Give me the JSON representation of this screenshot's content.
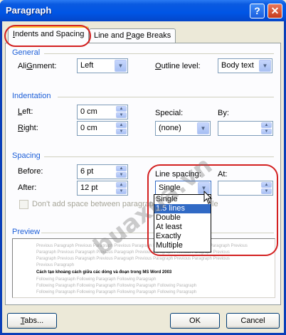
{
  "window": {
    "title": "Paragraph",
    "help_glyph": "?",
    "close_glyph": "✕"
  },
  "tabs": [
    {
      "label": "Indents and Spacing",
      "mnemonic": "I",
      "rest": "ndents and Spacing",
      "active": true
    },
    {
      "label": "Line and Page Breaks",
      "mnemonic": "P",
      "pre": "Line and ",
      "rest": "age Breaks",
      "active": false
    }
  ],
  "general": {
    "title": "General",
    "alignment_label": "Alignment:",
    "alignment_mn": "G",
    "alignment_value": "Left",
    "outline_label": "Outline level:",
    "outline_mn": "O",
    "outline_value": "Body text"
  },
  "indentation": {
    "title": "Indentation",
    "left_label": "Left:",
    "left_mn": "L",
    "left_value": "0 cm",
    "right_label": "Right:",
    "right_mn": "R",
    "right_value": "0 cm",
    "special_label": "Special:",
    "special_value": "(none)",
    "by_label": "By:",
    "by_value": ""
  },
  "spacing": {
    "title": "Spacing",
    "before_label": "Before:",
    "before_value": "6 pt",
    "after_label": "After:",
    "after_value": "12 pt",
    "line_spacing_label": "Line spacing:",
    "line_spacing_value": "Single",
    "at_label": "At:",
    "at_value": "",
    "dont_add_label": "Don't add space between paragraph",
    "dont_add_tail": "le",
    "line_spacing_options": [
      "Single",
      "1.5 lines",
      "Double",
      "At least",
      "Exactly",
      "Multiple"
    ],
    "line_spacing_selected": "1.5 lines"
  },
  "preview": {
    "title": "Preview",
    "previous_lines": [
      "Previous Paragraph Previous Paragraph Previous Paragraph Previous Paragraph Previous Paragraph Previous",
      "Paragraph Previous Paragraph Previous Paragraph Previous Paragraph Previous Paragraph Previous",
      "Paragraph Previous Paragraph Previous Paragraph Previous Paragraph Previous Paragraph Previous",
      "Previous Paragraph"
    ],
    "current_line": "Cách tạo khoảng cách giữa các dòng và đoạn trong MS Word 2003",
    "following_lines": [
      "Following Paragraph Following Paragraph Following Paragraph",
      "Following Paragraph Following Paragraph Following Paragraph Following Paragraph",
      "Following Paragraph Following Paragraph Following Paragraph Following Paragraph",
      "Following Paragraph Following Paragraph Following Paragraph Following Paragraph"
    ]
  },
  "buttons": {
    "tabs": "Tabs...",
    "ok": "OK",
    "cancel": "Cancel"
  },
  "watermark": "buaxua.vn",
  "colors": {
    "section_title": "#1d5fd8",
    "highlight_oval": "#d32020",
    "selection": "#316ac5"
  }
}
